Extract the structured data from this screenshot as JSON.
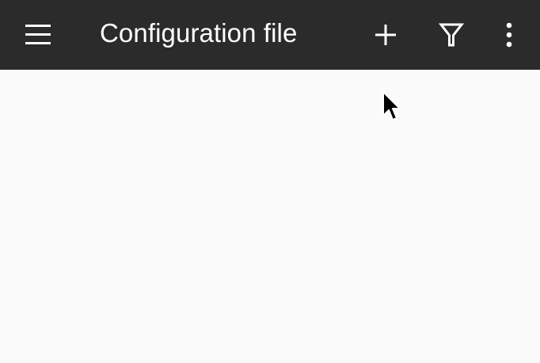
{
  "colors": {
    "toolbar_background": "#2b2b2b",
    "toolbar_foreground": "#ffffff",
    "content_background": "#fafafa"
  },
  "toolbar": {
    "title": "Configuration file",
    "icons": {
      "navigation": "hamburger-menu-icon",
      "add": "plus-icon",
      "filter": "filter-icon",
      "overflow": "more-vertical-icon"
    }
  },
  "pointer": {
    "icon": "mouse-cursor-icon"
  }
}
